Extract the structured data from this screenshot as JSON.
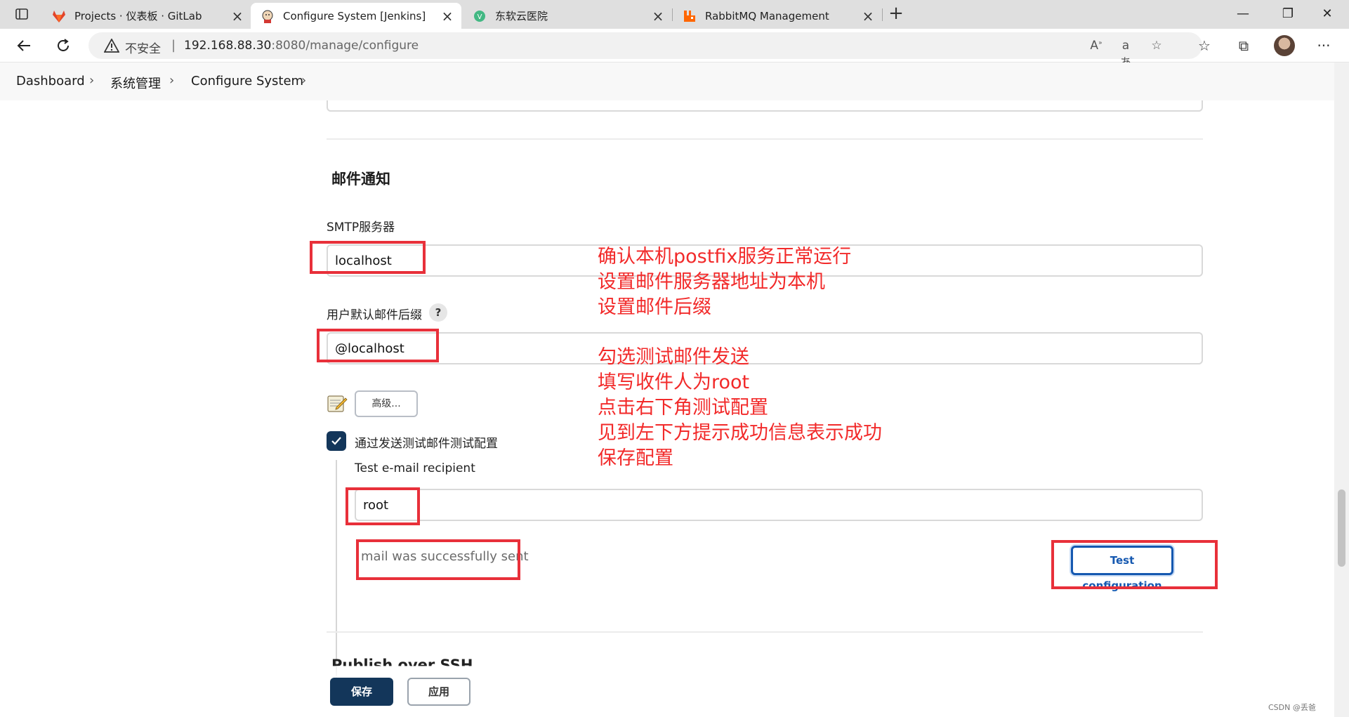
{
  "browser": {
    "tabs": [
      {
        "title": "Projects · 仪表板 · GitLab",
        "icon": "gitlab-icon",
        "active": false
      },
      {
        "title": "Configure System [Jenkins]",
        "icon": "jenkins-icon",
        "active": true
      },
      {
        "title": "东软云医院",
        "icon": "vue-icon",
        "active": false
      },
      {
        "title": "RabbitMQ Management",
        "icon": "rabbitmq-icon",
        "active": false
      }
    ],
    "security_label": "不安全",
    "url_host": "192.168.88.30",
    "url_rest": ":8080/manage/configure"
  },
  "breadcrumb": {
    "items": [
      "Dashboard",
      "系统管理",
      "Configure System"
    ]
  },
  "email_section": {
    "title": "邮件通知",
    "smtp_label": "SMTP服务器",
    "smtp_value": "localhost",
    "suffix_label": "用户默认邮件后缀",
    "help_label": "?",
    "suffix_value": "@localhost",
    "advanced_label": "高级...",
    "test_checkbox_label": "通过发送测试邮件测试配置",
    "test_checkbox_checked": true,
    "recipient_label": "Test e-mail recipient",
    "recipient_value": "root",
    "success_message": "mail was successfully sent",
    "test_button_label": "Test configuration"
  },
  "annotations": {
    "group1": [
      "确认本机postfix服务正常运行",
      "设置邮件服务器地址为本机",
      "设置邮件后缀"
    ],
    "group2": [
      "勾选测试邮件发送",
      "填写收件人为root",
      "点击右下角测试配置",
      "见到左下方提示成功信息表示成功",
      "保存配置"
    ]
  },
  "next_section_title": "Publish over SSH",
  "footer": {
    "save_label": "保存",
    "apply_label": "应用"
  },
  "watermark": "CSDN @丢爸",
  "colors": {
    "primary": "#13365a",
    "link_blue": "#1558b0",
    "annotation_red": "#e8303a"
  }
}
